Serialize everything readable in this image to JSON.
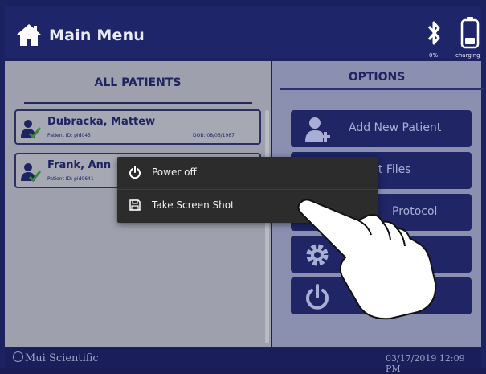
{
  "header": {
    "title": "Main Menu",
    "bluetooth_status": "0%",
    "battery_status": "charging"
  },
  "patients_panel": {
    "title": "ALL PATIENTS",
    "patients": [
      {
        "name": "Dubracka, Mattew",
        "patient_id": "Patient ID: pid045",
        "dob": "DOB: 08/06/1987"
      },
      {
        "name": "Frank, Ann",
        "patient_id": "Patient ID: pid0641",
        "dob": ""
      }
    ]
  },
  "options_panel": {
    "title": "OPTIONS",
    "buttons": [
      {
        "label": "Add New Patient",
        "icon": "add-user-icon"
      },
      {
        "label": "nt Files",
        "icon": ""
      },
      {
        "label": "Protocol",
        "icon": ""
      },
      {
        "label": "",
        "icon": "gear-icon"
      },
      {
        "label": "",
        "icon": "power-icon"
      }
    ]
  },
  "context_menu": {
    "items": [
      {
        "label": "Power off",
        "icon": "power-icon"
      },
      {
        "label": "Take Screen Shot",
        "icon": "save-icon"
      }
    ]
  },
  "footer": {
    "brand": "Mui Scientific",
    "datetime": "03/17/2019 12:09 PM"
  },
  "colors": {
    "header_bg": "#1e2569",
    "accent_green": "#3a8a3a",
    "menu_bg": "#2c2c2c"
  }
}
